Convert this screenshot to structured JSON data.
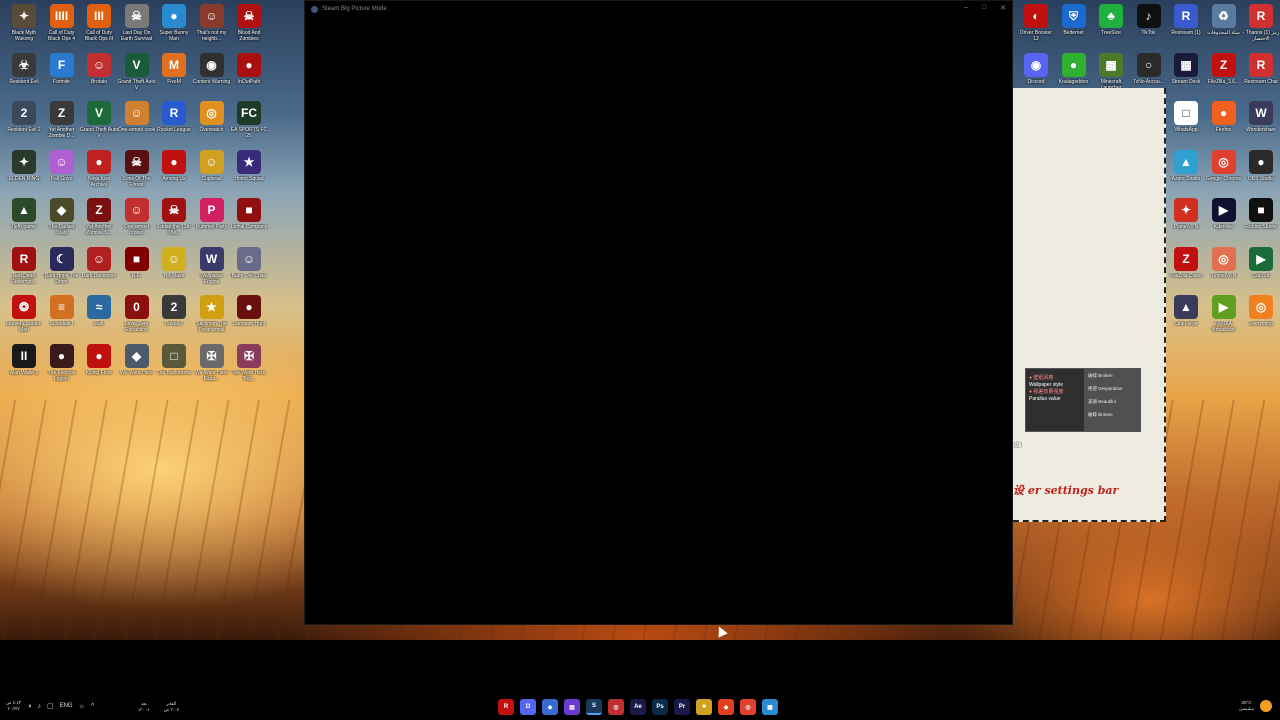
{
  "window": {
    "title": "Steam Big Picture Mode",
    "controls": [
      "–",
      "□",
      "✕"
    ]
  },
  "desktop_left": [
    {
      "label": "Black Myth Wukong",
      "color": "#5a4a3a",
      "glyph": "✦"
    },
    {
      "label": "Call of Duty Black Ops 4",
      "color": "#e06010",
      "glyph": "IIII"
    },
    {
      "label": "Call of Duty Black Ops III",
      "color": "#e06010",
      "glyph": "III"
    },
    {
      "label": "Last Day On Earth Survival",
      "color": "#7a7a7a",
      "glyph": "☠"
    },
    {
      "label": "Super Bunny Man",
      "color": "#2a8ad0",
      "glyph": "●"
    },
    {
      "label": "That's not my neighb...",
      "color": "#8a3a2a",
      "glyph": "☺"
    },
    {
      "label": "Blood And Zombies",
      "color": "#b01010",
      "glyph": "☠"
    },
    {
      "label": "Resident Evil",
      "color": "#3a3a3a",
      "glyph": "☣"
    },
    {
      "label": "Fortnite",
      "color": "#2a7ad0",
      "glyph": "F"
    },
    {
      "label": "Brotato",
      "color": "#c03030",
      "glyph": "☺"
    },
    {
      "label": "Grand Theft Auto V",
      "color": "#1a5a3a",
      "glyph": "V"
    },
    {
      "label": "FiveM",
      "color": "#e07020",
      "glyph": "M"
    },
    {
      "label": "Content Warning",
      "color": "#303030",
      "glyph": "◉"
    },
    {
      "label": "InOutPath",
      "color": "#aa1010",
      "glyph": "●"
    },
    {
      "label": "Resident Evil 2",
      "color": "#3a4a5a",
      "glyph": "2"
    },
    {
      "label": "Yet Another Zombie D...",
      "color": "#3a3a3a",
      "glyph": "Z"
    },
    {
      "label": "Grand Theft Auto V",
      "color": "#1a6a3a",
      "glyph": "V"
    },
    {
      "label": "One-armed cook",
      "color": "#d08030",
      "glyph": "☺"
    },
    {
      "label": "Rocket League",
      "color": "#2a5ad0",
      "glyph": "R"
    },
    {
      "label": "Overwatch",
      "color": "#e09020",
      "glyph": "◎"
    },
    {
      "label": "EA SPORTS FC 25",
      "color": "#203a2a",
      "glyph": "FC"
    },
    {
      "label": "ELDEN RING",
      "color": "#2a3a2a",
      "glyph": "✦"
    },
    {
      "label": "Fall Guys",
      "color": "#b060d0",
      "glyph": "☺"
    },
    {
      "label": "Ninja Kiwi Archive",
      "color": "#c02020",
      "glyph": "●"
    },
    {
      "label": "Sons Of The Forest",
      "color": "#5a1010",
      "glyph": "☠"
    },
    {
      "label": "Among Us",
      "color": "#c01010",
      "glyph": "●"
    },
    {
      "label": "Cuphead",
      "color": "#d0a020",
      "glyph": "☺"
    },
    {
      "label": "Homo Squad",
      "color": "#3a2a7a",
      "glyph": "★"
    },
    {
      "label": "(left) game",
      "color": "#2a4a2a",
      "glyph": "▲"
    },
    {
      "label": "The Outlast Trials",
      "color": "#4a4a2a",
      "glyph": "◆"
    },
    {
      "label": "Yet Another Zombie S...",
      "color": "#7a1010",
      "glyph": "Z"
    },
    {
      "label": "One-armed robber",
      "color": "#c03030",
      "glyph": "☺"
    },
    {
      "label": "Friday the 13th The...",
      "color": "#a01010",
      "glyph": "☠"
    },
    {
      "label": "Pummel Party",
      "color": "#d02060",
      "glyph": "P"
    },
    {
      "label": "Lethal Company",
      "color": "#901010",
      "glyph": "■"
    },
    {
      "label": "Red Dead Redempti...",
      "color": "#a01010",
      "glyph": "R"
    },
    {
      "label": "Dark Hope The Dorm",
      "color": "#2a2a5a",
      "glyph": "☾"
    },
    {
      "label": "Dark Deception",
      "color": "#b02020",
      "glyph": "☺"
    },
    {
      "label": "R.E.",
      "color": "#800000",
      "glyph": "■"
    },
    {
      "label": "Hill Maze",
      "color": "#d0b020",
      "glyph": "☺"
    },
    {
      "label": "Wallpaper Engine",
      "color": "#3a3a6a",
      "glyph": "W"
    },
    {
      "label": "Baby The Chair",
      "color": "#6a6a8a",
      "glyph": "☺"
    },
    {
      "label": "Marvel's Spider-Man",
      "color": "#c01010",
      "glyph": "❂"
    },
    {
      "label": "Schedule I",
      "color": "#d07020",
      "glyph": "≡"
    },
    {
      "label": "Raft",
      "color": "#2a6aa0",
      "glyph": "≈"
    },
    {
      "label": "Level Zero Extraction",
      "color": "#8a1010",
      "glyph": "0"
    },
    {
      "label": "Postal 2",
      "color": "#3a3a3a",
      "glyph": "2"
    },
    {
      "label": "Stickman The Paranormal",
      "color": "#d0a010",
      "glyph": "★"
    },
    {
      "label": "Dungeon Hunt",
      "color": "#6a1010",
      "glyph": "●"
    },
    {
      "label": "Alan Wake 2",
      "color": "#1a1a1a",
      "glyph": "II"
    },
    {
      "label": "The Exorcist Legion",
      "color": "#3a1a1a",
      "glyph": "●"
    },
    {
      "label": "Killing Floor",
      "color": "#c01010",
      "glyph": "●"
    },
    {
      "label": "We Were Here",
      "color": "#4a5a6a",
      "glyph": "◆"
    },
    {
      "label": "The Backrooms",
      "color": "#5a5a3a",
      "glyph": "□"
    },
    {
      "label": "We Were Here Expa...",
      "color": "#6a6a6a",
      "glyph": "✠"
    },
    {
      "label": "We Were Here Tog...",
      "color": "#8a3a5a",
      "glyph": "✠"
    }
  ],
  "desktop_right": [
    {
      "label": "Driver Booster 12",
      "color": "#c01010",
      "glyph": "◐"
    },
    {
      "label": "Betternet",
      "color": "#1a6ad0",
      "glyph": "⛨"
    },
    {
      "label": "TreeSize",
      "color": "#20b040",
      "glyph": "♣"
    },
    {
      "label": "TikTok",
      "color": "#101010",
      "glyph": "♪"
    },
    {
      "label": "Restream (1)",
      "color": "#3a5ad0",
      "glyph": "R"
    },
    {
      "label": "سلة المحذوفات",
      "color": "#5a7aa0",
      "glyph": "♻"
    },
    {
      "label": "- Thanos (1) رمز الاختصار",
      "color": "#d03030",
      "glyph": "R"
    },
    {
      "label": "Discord",
      "color": "#5865f2",
      "glyph": "◉"
    },
    {
      "label": "Koalageddon",
      "color": "#30b030",
      "glyph": "●"
    },
    {
      "label": "Minecraft Launcher",
      "color": "#4a7a2a",
      "glyph": "▦"
    },
    {
      "label": "TcNo Accou...",
      "color": "#2a2a2a",
      "glyph": "○"
    },
    {
      "label": "Stream Deck",
      "color": "#1a1a3a",
      "glyph": "▦"
    },
    {
      "label": "FileZilla_3.6...",
      "color": "#c01010",
      "glyph": "Z"
    },
    {
      "label": "Restream Chat",
      "color": "#d03030",
      "glyph": "R"
    },
    {
      "label": "TreeSize Free",
      "color": "#20b040",
      "glyph": "♣"
    },
    {
      "label": "VLC",
      "color": "#f08020",
      "glyph": "▲"
    },
    {
      "label": "Cloudflare WARP",
      "color": "#f08020",
      "glyph": "☁"
    },
    {
      "label": "(network)",
      "color": "#3a3a3a",
      "glyph": "✸"
    },
    {
      "label": "WhatsApp",
      "color": "#ffffff",
      "glyph": "□"
    },
    {
      "label": "Firefox",
      "color": "#f06020",
      "glyph": "●"
    },
    {
      "label": "Wondershare",
      "color": "#3a3a5a",
      "glyph": "W"
    },
    {
      "label": "Wallpaper Engine",
      "color": "#2a6ad0",
      "glyph": "◎"
    },
    {
      "label": "Razer Synapse",
      "color": "#30c030",
      "glyph": "❂"
    },
    {
      "label": "Razer Cortex",
      "color": "#101010",
      "glyph": "▶"
    },
    {
      "label": "(app)",
      "color": "#8a9ad0",
      "glyph": "◎"
    },
    {
      "label": "Azure Studio",
      "color": "#30a0d0",
      "glyph": "▲"
    },
    {
      "label": "Google Chrome",
      "color": "#e04030",
      "glyph": "◎"
    },
    {
      "label": "OBS Studio",
      "color": "#2a2a2a",
      "glyph": "●"
    },
    {
      "label": "Grammarly",
      "color": "#15a070",
      "glyph": "G"
    },
    {
      "label": "Overwolf",
      "color": "#2a2a2a",
      "glyph": "✦"
    },
    {
      "label": "TikTok LIVE Studio",
      "color": "#d02060",
      "glyph": "♪"
    },
    {
      "label": "CCleaner",
      "color": "#6a1a1a",
      "glyph": "●"
    },
    {
      "label": "PlanetVPN",
      "color": "#d03020",
      "glyph": "✦"
    },
    {
      "label": "Kdenlive",
      "color": "#101030",
      "glyph": "▶"
    },
    {
      "label": "Roblox Studio",
      "color": "#101010",
      "glyph": "■"
    },
    {
      "label": "Hypixel Nvidia",
      "color": "#c02020",
      "glyph": "◎"
    },
    {
      "label": "Blender 3.6",
      "color": "#f08020",
      "glyph": "◎"
    },
    {
      "label": "TikTok LIVE Studio",
      "color": "#d02060",
      "glyph": "♪"
    },
    {
      "label": "Brave",
      "color": "#e04020",
      "glyph": "◆"
    },
    {
      "label": "FileZilla Client",
      "color": "#c01010",
      "glyph": "Z"
    },
    {
      "label": "TunnelVPN",
      "color": "#e07050",
      "glyph": "◎"
    },
    {
      "label": "CapCut",
      "color": "#1a6a3a",
      "glyph": "▶"
    },
    {
      "label": "Ubisoft Connect",
      "color": "#3a3a6a",
      "glyph": "◎"
    },
    {
      "label": "PC Manager",
      "color": "#2a8ad0",
      "glyph": "♣"
    },
    {
      "label": "(app)",
      "color": "#3a8a4a",
      "glyph": "▲"
    },
    {
      "label": "CrystalDisk",
      "color": "#3a5ad0",
      "glyph": "▦"
    },
    {
      "label": "CineForge",
      "color": "#3a3a5a",
      "glyph": "▲"
    },
    {
      "label": "NVIDIA Broadcast",
      "color": "#60a020",
      "glyph": "▶"
    },
    {
      "label": "Everything",
      "color": "#f08020",
      "glyph": "◎"
    },
    {
      "label": "Tools Revolution",
      "color": "#c03030",
      "glyph": "◎"
    },
    {
      "label": "(app)",
      "color": "#3ab0d0",
      "glyph": "◎"
    },
    {
      "label": "ProtonVPN",
      "color": "#6a3ad0",
      "glyph": "▼"
    },
    {
      "label": "Hardware Info",
      "color": "#20a080",
      "glyph": "◎"
    }
  ],
  "settings_card": {
    "left_lines": [
      "● 壁纸风格",
      "Wallpaper style",
      "● 视差效果强度",
      "Parallax value"
    ],
    "right_rows": [
      "破碎 Broken",
      "绝望 Desperation",
      "美丽 Beautiful",
      "破碎 Broken"
    ],
    "small_text": "设)",
    "caption": "设 er settings bar"
  },
  "taskbar": {
    "clock": [
      "٤:٤٣ ص",
      "٢٠/٧/٧"
    ],
    "system_glyphs": [
      "◑",
      "♪",
      "▢",
      "☼",
      "^"
    ],
    "language": "ENG",
    "prayer": [
      [
        "بعد",
        "٢٠٠٤ذ"
      ],
      [
        "الفجر",
        "٢:٠٧ ص"
      ]
    ],
    "apps": [
      {
        "label": "R",
        "color": "#c01010",
        "active": false
      },
      {
        "label": "D",
        "color": "#5865f2",
        "active": false
      },
      {
        "label": "◆",
        "color": "#3a6ad0",
        "active": false
      },
      {
        "label": "▤",
        "color": "#6a3ad0",
        "active": false
      },
      {
        "label": "S",
        "color": "#1a3a5a",
        "active": true
      },
      {
        "label": "◎",
        "color": "#c03030",
        "active": false
      },
      {
        "label": "Ae",
        "color": "#1a1a4a",
        "active": false
      },
      {
        "label": "Ps",
        "color": "#0a2a4a",
        "active": false
      },
      {
        "label": "Pr",
        "color": "#1a1a4a",
        "active": false
      },
      {
        "label": "■",
        "color": "#d0a020",
        "active": false
      },
      {
        "label": "◆",
        "color": "#e04020",
        "active": false
      },
      {
        "label": "◎",
        "color": "#e04030",
        "active": false
      },
      {
        "label": "▦",
        "color": "#2a8ad0",
        "active": false
      }
    ],
    "weather": [
      "28°C",
      "مشمس"
    ]
  }
}
